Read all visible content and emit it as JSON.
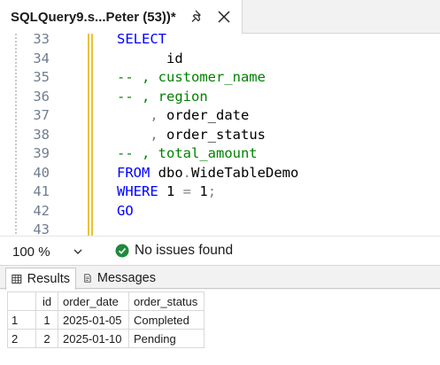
{
  "tab": {
    "title": "SQLQuery9.s...Peter (53))*"
  },
  "editor": {
    "lines": [
      {
        "num": "33",
        "parts": [
          {
            "t": "SELECT",
            "c": "kw"
          }
        ]
      },
      {
        "num": "34",
        "parts": [
          {
            "t": "      id",
            "c": "tx"
          }
        ]
      },
      {
        "num": "35",
        "parts": [
          {
            "t": "-- , customer_name",
            "c": "cm"
          }
        ]
      },
      {
        "num": "36",
        "parts": [
          {
            "t": "-- , region",
            "c": "cm"
          }
        ]
      },
      {
        "num": "37",
        "parts": [
          {
            "t": "    ",
            "c": "tx"
          },
          {
            "t": ",",
            "c": "op"
          },
          {
            "t": " order_date",
            "c": "tx"
          }
        ]
      },
      {
        "num": "38",
        "parts": [
          {
            "t": "    ",
            "c": "tx"
          },
          {
            "t": ",",
            "c": "op"
          },
          {
            "t": " order_status",
            "c": "tx"
          }
        ]
      },
      {
        "num": "39",
        "parts": [
          {
            "t": "-- , total_amount",
            "c": "cm"
          }
        ]
      },
      {
        "num": "40",
        "parts": [
          {
            "t": "FROM",
            "c": "kw"
          },
          {
            "t": " dbo",
            "c": "tx"
          },
          {
            "t": ".",
            "c": "op"
          },
          {
            "t": "WideTableDemo",
            "c": "tx"
          }
        ]
      },
      {
        "num": "41",
        "parts": [
          {
            "t": "WHERE",
            "c": "kw"
          },
          {
            "t": " 1 ",
            "c": "tx"
          },
          {
            "t": "=",
            "c": "op"
          },
          {
            "t": " 1",
            "c": "tx"
          },
          {
            "t": ";",
            "c": "op"
          }
        ]
      },
      {
        "num": "42",
        "parts": [
          {
            "t": "GO",
            "c": "kw"
          }
        ]
      },
      {
        "num": "43",
        "parts": []
      }
    ]
  },
  "status": {
    "zoom": "100 %",
    "issues": "No issues found"
  },
  "results": {
    "tabs": {
      "results": "Results",
      "messages": "Messages"
    },
    "columns": [
      "id",
      "order_date",
      "order_status"
    ],
    "rows": [
      {
        "rownum": "1",
        "id": "1",
        "order_date": "2025-01-05",
        "order_status": "Completed"
      },
      {
        "rownum": "2",
        "id": "2",
        "order_date": "2025-01-10",
        "order_status": "Pending"
      }
    ]
  },
  "colors": {
    "keyword": "#0000ff",
    "comment": "#008000",
    "line_number": "#6f7e8f",
    "ok_green": "#1e8a3c",
    "indent_guide": "#e8c23a"
  },
  "icons": {
    "pin": "pin-icon",
    "close": "close-icon",
    "zoom_dropdown": "chevron-down-icon",
    "issues": "check-circle-icon",
    "results_tab": "grid-icon",
    "messages_tab": "document-icon"
  }
}
